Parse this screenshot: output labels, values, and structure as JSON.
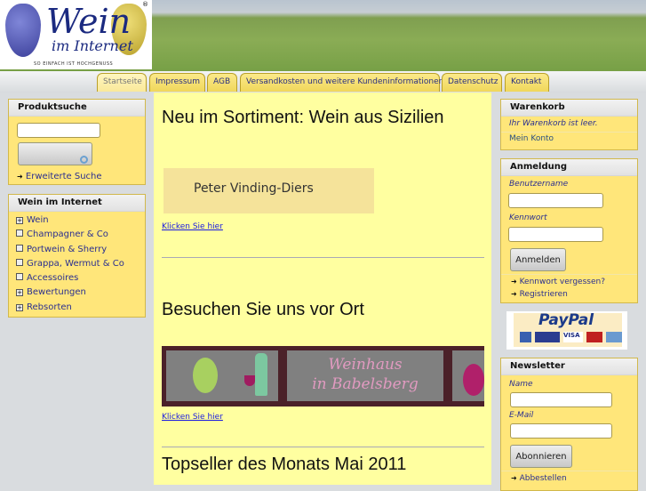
{
  "logo": {
    "title": "Wein",
    "subtitle": "im Internet",
    "tagline": "SO EINFACH IST HOCHGENUSS",
    "registered": "®"
  },
  "nav": {
    "tabs": [
      {
        "label": "Startseite",
        "active": true
      },
      {
        "label": "Impressum"
      },
      {
        "label": "AGB"
      },
      {
        "label": "Versandkosten und weitere Kundeninformationen"
      },
      {
        "label": "Datenschutz"
      },
      {
        "label": "Kontakt"
      }
    ]
  },
  "search": {
    "title": "Produktsuche",
    "value": "",
    "advanced": "Erweiterte Suche"
  },
  "categories": {
    "title": "Wein im Internet",
    "items": [
      {
        "label": "Wein",
        "expand": true
      },
      {
        "label": "Champagner & Co",
        "expand": false
      },
      {
        "label": "Portwein & Sherry",
        "expand": false
      },
      {
        "label": "Grappa, Wermut & Co",
        "expand": false
      },
      {
        "label": "Accessoires",
        "expand": false
      },
      {
        "label": "Bewertungen",
        "expand": true
      },
      {
        "label": "Rebsorten",
        "expand": true
      }
    ]
  },
  "main": {
    "heading1": "Neu im Sortiment: Wein aus Sizilien",
    "banner1": "Peter Vinding-Diers",
    "link1": "Klicken Sie hier",
    "heading2": "Besuchen Sie uns vor Ort",
    "banner2_line1": "Weinhaus",
    "banner2_line2": "in Babelsberg",
    "link2": "Klicken Sie hier",
    "heading3": "Topseller des Monats Mai 2011"
  },
  "cart": {
    "title": "Warenkorb",
    "empty": "Ihr Warenkorb ist leer.",
    "account": "Mein Konto"
  },
  "login": {
    "title": "Anmeldung",
    "username_label": "Benutzername",
    "password_label": "Kennwort",
    "button": "Anmelden",
    "forgot": "Kennwort vergessen?",
    "register": "Registrieren"
  },
  "paypal": {
    "brand": "PayPal",
    "cards": [
      "EC",
      "giropay",
      "VISA",
      "MasterCard",
      "AmEx"
    ]
  },
  "newsletter": {
    "title": "Newsletter",
    "name_label": "Name",
    "email_label": "E-Mail",
    "button": "Abonnieren",
    "unsubscribe": "Abbestellen"
  }
}
